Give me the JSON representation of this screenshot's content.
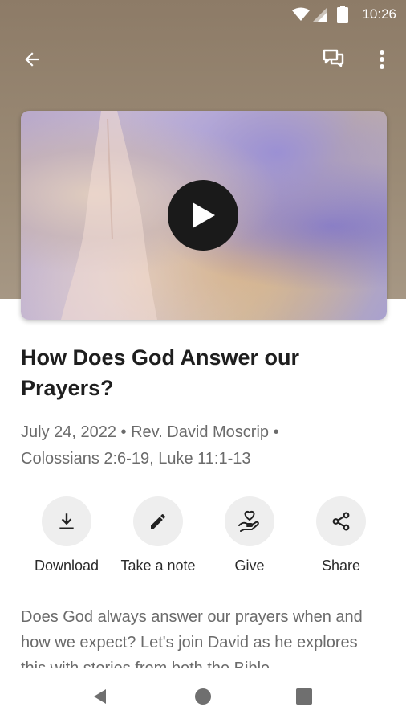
{
  "status_bar": {
    "time": "10:26",
    "icons": [
      "wifi-icon",
      "signal-icon",
      "battery-icon"
    ]
  },
  "app_bar": {
    "icons": [
      "back-arrow-icon",
      "chat-icon",
      "more-vert-icon"
    ]
  },
  "video": {
    "play_icon": "play-icon"
  },
  "sermon": {
    "title": "How Does God Answer our Prayers?",
    "date": "July 24, 2022",
    "speaker": "Rev. David Moscrip",
    "scripture": "Colossians 2:6-19, Luke 11:1-13",
    "separator": " • "
  },
  "actions": [
    {
      "label": "Download",
      "icon": "download-icon"
    },
    {
      "label": "Take a note",
      "icon": "pencil-icon"
    },
    {
      "label": "Give",
      "icon": "give-hand-heart-icon"
    },
    {
      "label": "Share",
      "icon": "share-icon"
    }
  ],
  "description": "Does God always answer our prayers when and how we expect? Let's join David as he explores this with stories from both the Bible",
  "colors": {
    "header": "#9b8b76",
    "play_button": "#1a1a1a",
    "action_circle": "#eeeeee",
    "title": "#1e1e1e",
    "meta": "#6b6b6b"
  }
}
